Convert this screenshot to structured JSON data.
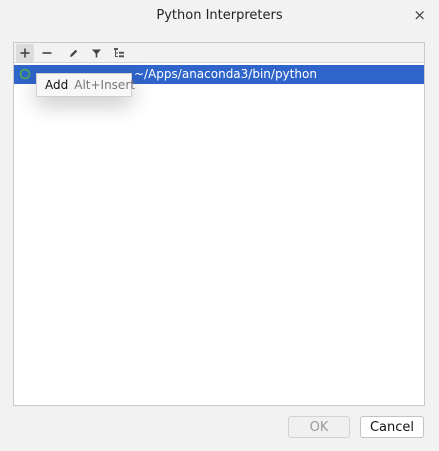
{
  "window": {
    "title": "Python Interpreters",
    "close_glyph": "×"
  },
  "toolbar": {
    "add_icon": "plus-icon",
    "remove_icon": "minus-icon",
    "edit_icon": "pencil-icon",
    "filter_icon": "filter-icon",
    "tree_icon": "tree-view-icon"
  },
  "interpreters": [
    {
      "label": "~/Apps/anaconda3/bin/python",
      "selected": true,
      "status_icon": "interpreter-icon"
    }
  ],
  "tooltip": {
    "label": "Add",
    "shortcut": "Alt+Insert"
  },
  "buttons": {
    "ok": "OK",
    "cancel": "Cancel"
  },
  "colors": {
    "selection": "#2f65ca",
    "status_icon": "#4caf50"
  }
}
